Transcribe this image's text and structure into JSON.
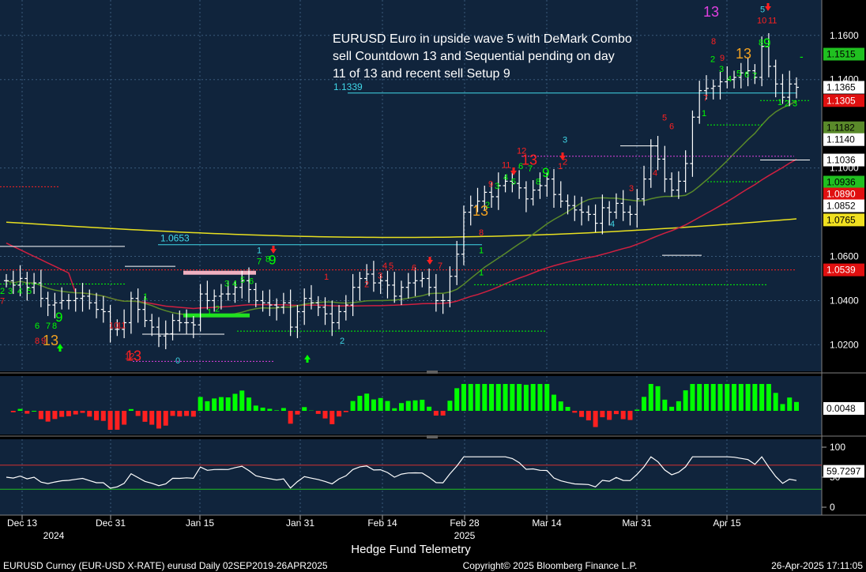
{
  "header_title": "EURUSD Euro in upside wave 5 with DeMark Combo sell Countdown 13 and Sequential pending on day 11 of 13 and recent sell Setup 9",
  "header_lines": [
    "EURUSD Euro in upside wave 5 with DeMark Combo",
    "sell Countdown 13 and Sequential pending on day",
    "11 of 13 and recent sell Setup 9"
  ],
  "footer": {
    "left": "EURUSD Curncy (EUR-USD X-RATE) eurusd  Daily 02SEP2019-26APR2025",
    "center": "Copyright© 2025 Bloomberg Finance L.P.",
    "right": "26-Apr-2025 17:11:05",
    "attribution": "Hedge Fund Telemetry"
  },
  "colors": {
    "panel_bg": "#10243c",
    "up": "#00ff00",
    "down": "#ff2020",
    "cyan": "#40d8e8",
    "orange": "#f0a020",
    "magenta": "#e040e0",
    "yellow_ma": "#e8e020",
    "red_ma": "#d02040",
    "green_ma": "#5a8a2a"
  },
  "chart_data": [
    {
      "type": "ohlc",
      "name": "price",
      "x_tick_labels": [
        "Dec 13",
        "Dec 31",
        "Jan 15",
        "Jan 31",
        "Feb 14",
        "Feb 28",
        "Mar 14",
        "Mar 31",
        "Apr 15"
      ],
      "x_year_labels": [
        "2024",
        "2025"
      ],
      "y_tick_labels": [
        "1.1600",
        "1.1400",
        "1.1000",
        "1.0600",
        "1.0400",
        "1.0200"
      ],
      "ylim": [
        1.008,
        1.176
      ],
      "level_labels": [
        {
          "text": "1.1339",
          "value": 1.1339
        },
        {
          "text": "1.0653",
          "value": 1.0653
        }
      ],
      "right_badges": [
        {
          "text": "1.1515",
          "value": 1.1515,
          "bg": "#20c020",
          "fg": "#000000"
        },
        {
          "text": "1.1365",
          "value": 1.1365,
          "bg": "#ffffff",
          "fg": "#000000"
        },
        {
          "text": "1.1305",
          "value": 1.1305,
          "bg": "#e01010",
          "fg": "#ffffff"
        },
        {
          "text": "1.1182",
          "value": 1.1182,
          "bg": "#5a8a2a",
          "fg": "#000000"
        },
        {
          "text": "1.1140",
          "value": 1.114,
          "bg": "#ffffff",
          "fg": "#000000"
        },
        {
          "text": "1.1036",
          "value": 1.1036,
          "bg": "#ffffff",
          "fg": "#000000"
        },
        {
          "text": "1.0936",
          "value": 1.0936,
          "bg": "#20c020",
          "fg": "#000000"
        },
        {
          "text": "1.0890",
          "value": 1.089,
          "bg": "#e01010",
          "fg": "#ffffff"
        },
        {
          "text": "1.0852",
          "value": 1.0852,
          "bg": "#ffffff",
          "fg": "#000000"
        },
        {
          "text": "1.0765",
          "value": 1.0765,
          "bg": "#f0e020",
          "fg": "#000000"
        },
        {
          "text": "1.0539",
          "value": 1.0539,
          "bg": "#e01010",
          "fg": "#ffffff"
        }
      ],
      "closes": [
        1.049,
        1.047,
        1.05,
        1.046,
        1.048,
        1.041,
        1.038,
        1.039,
        1.04,
        1.04,
        1.041,
        1.042,
        1.039,
        1.036,
        1.035,
        1.027,
        1.027,
        1.03,
        1.041,
        1.036,
        1.031,
        1.028,
        1.024,
        1.025,
        1.031,
        1.03,
        1.03,
        1.029,
        1.043,
        1.04,
        1.042,
        1.043,
        1.043,
        1.046,
        1.049,
        1.045,
        1.04,
        1.039,
        1.038,
        1.037,
        1.039,
        1.028,
        1.035,
        1.041,
        1.039,
        1.037,
        1.034,
        1.03,
        1.035,
        1.038,
        1.046,
        1.05,
        1.052,
        1.048,
        1.049,
        1.047,
        1.042,
        1.046,
        1.048,
        1.049,
        1.05,
        1.046,
        1.04,
        1.04,
        1.051,
        1.061,
        1.08,
        1.083,
        1.085,
        1.089,
        1.087,
        1.092,
        1.094,
        1.093,
        1.091,
        1.086,
        1.09,
        1.092,
        1.095,
        1.088,
        1.085,
        1.083,
        1.081,
        1.08,
        1.079,
        1.075,
        1.082,
        1.08,
        1.084,
        1.08,
        1.079,
        1.086,
        1.095,
        1.11,
        1.104,
        1.095,
        1.09,
        1.094,
        1.102,
        1.123,
        1.135,
        1.136,
        1.137,
        1.139,
        1.14,
        1.141,
        1.143,
        1.144,
        1.141,
        1.155,
        1.146,
        1.138,
        1.132,
        1.138,
        1.1365
      ]
    },
    {
      "type": "bar",
      "name": "momentum",
      "latest_value": "0.0048"
    },
    {
      "type": "line",
      "name": "oscillator",
      "y_tick_labels": [
        "100",
        "50",
        "0"
      ],
      "ylim": [
        0,
        100
      ],
      "latest_value": "59.7297"
    }
  ]
}
